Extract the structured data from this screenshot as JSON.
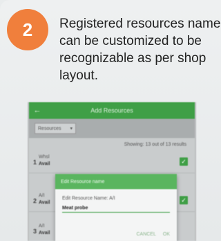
{
  "step": {
    "number": "2",
    "color": "#f07f3c"
  },
  "description": "Registered resources name can be customized to be recognizable as per shop layout.",
  "phone": {
    "appbar": {
      "back_icon": "arrow-left-icon",
      "title": "Add Resources"
    },
    "toolbar": {
      "select_label": "Resources",
      "select_icon": "chevron-down-icon"
    },
    "showing": "Showing: 13 out of 13 results",
    "rows": [
      {
        "num": "1",
        "name": "Whsl",
        "sub": "Avail",
        "checked": true
      },
      {
        "num": "2",
        "name": "A/I",
        "sub": "Avail",
        "checked": true
      },
      {
        "num": "3",
        "name": "A/I",
        "sub": "Avail",
        "checked": false
      }
    ],
    "dialog": {
      "title": "Edit Resource name",
      "field_label": "Edit Resource Name: A/I",
      "field_value": "Meat probe",
      "cancel_label": "CANCEL",
      "ok_label": "OK"
    }
  },
  "colors": {
    "accent": "#3f9f46",
    "badge": "#f07f3c"
  }
}
